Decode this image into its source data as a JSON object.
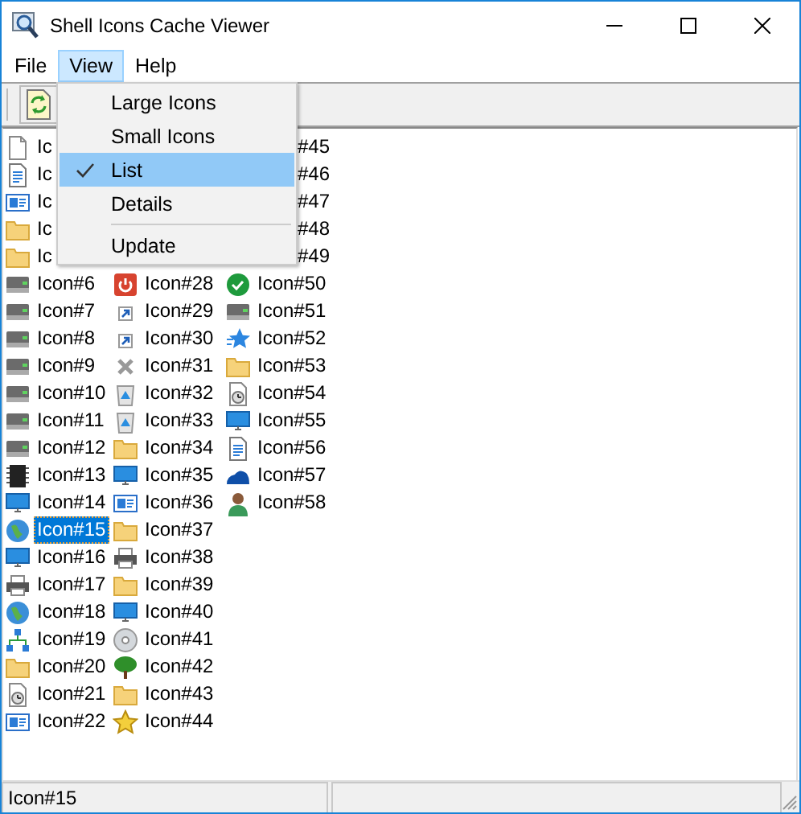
{
  "window": {
    "title": "Shell Icons Cache Viewer"
  },
  "menu_bar": [
    {
      "label": "File",
      "selected": false
    },
    {
      "label": "View",
      "selected": true
    },
    {
      "label": "Help",
      "selected": false
    }
  ],
  "dropdown": [
    {
      "kind": "option",
      "label": "Large Icons",
      "checked": false,
      "selected": false
    },
    {
      "kind": "option",
      "label": "Small Icons",
      "checked": false,
      "selected": false
    },
    {
      "kind": "option",
      "label": "List",
      "checked": true,
      "selected": true
    },
    {
      "kind": "option",
      "label": "Details",
      "checked": false,
      "selected": false
    },
    {
      "kind": "separator"
    },
    {
      "kind": "option",
      "label": "Update",
      "checked": false,
      "selected": false
    }
  ],
  "icon_list": {
    "columns": [
      {
        "items": [
          {
            "kind": "item",
            "label": "Ic",
            "selected": false
          },
          {
            "kind": "item",
            "label": "Ic",
            "selected": false
          },
          {
            "kind": "item",
            "label": "Ic",
            "selected": false
          },
          {
            "kind": "item",
            "label": "Ic",
            "selected": false
          },
          {
            "kind": "item",
            "label": "Ic",
            "selected": false
          },
          {
            "kind": "item",
            "label": "Icon#6",
            "selected": false
          },
          {
            "kind": "item",
            "label": "Icon#7",
            "selected": false
          },
          {
            "kind": "item",
            "label": "Icon#8",
            "selected": false
          },
          {
            "kind": "item",
            "label": "Icon#9",
            "selected": false
          },
          {
            "kind": "item",
            "label": "Icon#10",
            "selected": false
          },
          {
            "kind": "item",
            "label": "Icon#11",
            "selected": false
          },
          {
            "kind": "item",
            "label": "Icon#12",
            "selected": false
          },
          {
            "kind": "item",
            "label": "Icon#13",
            "selected": false
          },
          {
            "kind": "item",
            "label": "Icon#14",
            "selected": false
          },
          {
            "kind": "item",
            "label": "Icon#15",
            "selected": true
          },
          {
            "kind": "item",
            "label": "Icon#16",
            "selected": false
          },
          {
            "kind": "item",
            "label": "Icon#17",
            "selected": false
          },
          {
            "kind": "item",
            "label": "Icon#18",
            "selected": false
          },
          {
            "kind": "item",
            "label": "Icon#19",
            "selected": false
          },
          {
            "kind": "item",
            "label": "Icon#20",
            "selected": false
          },
          {
            "kind": "item",
            "label": "Icon#21",
            "selected": false
          },
          {
            "kind": "item",
            "label": "Icon#22",
            "selected": false
          }
        ]
      },
      {
        "items": [
          {
            "kind": "item",
            "label": "Icon#28",
            "selected": false
          },
          {
            "kind": "item",
            "label": "Icon#29",
            "selected": false
          },
          {
            "kind": "item",
            "label": "Icon#30",
            "selected": false
          },
          {
            "kind": "item",
            "label": "Icon#31",
            "selected": false
          },
          {
            "kind": "item",
            "label": "Icon#32",
            "selected": false
          },
          {
            "kind": "item",
            "label": "Icon#33",
            "selected": false
          },
          {
            "kind": "item",
            "label": "Icon#34",
            "selected": false
          },
          {
            "kind": "item",
            "label": "Icon#35",
            "selected": false
          },
          {
            "kind": "item",
            "label": "Icon#36",
            "selected": false
          },
          {
            "kind": "item",
            "label": "Icon#37",
            "selected": false
          },
          {
            "kind": "item",
            "label": "Icon#38",
            "selected": false
          },
          {
            "kind": "item",
            "label": "Icon#39",
            "selected": false
          },
          {
            "kind": "item",
            "label": "Icon#40",
            "selected": false
          },
          {
            "kind": "item",
            "label": "Icon#41",
            "selected": false
          },
          {
            "kind": "item",
            "label": "Icon#42",
            "selected": false
          },
          {
            "kind": "item",
            "label": "Icon#43",
            "selected": false
          },
          {
            "kind": "item",
            "label": "Icon#44",
            "selected": false
          }
        ]
      },
      {
        "items": [
          {
            "kind": "cut",
            "label": "#45",
            "selected": false
          },
          {
            "kind": "cut",
            "label": "#46",
            "selected": false
          },
          {
            "kind": "cut",
            "label": "#47",
            "selected": false
          },
          {
            "kind": "cut",
            "label": "#48",
            "selected": false
          },
          {
            "kind": "cut",
            "label": "#49",
            "selected": false
          },
          {
            "kind": "item",
            "label": "Icon#50",
            "selected": false
          },
          {
            "kind": "item",
            "label": "Icon#51",
            "selected": false
          },
          {
            "kind": "item",
            "label": "Icon#52",
            "selected": false
          },
          {
            "kind": "item",
            "label": "Icon#53",
            "selected": false
          },
          {
            "kind": "item",
            "label": "Icon#54",
            "selected": false
          },
          {
            "kind": "item",
            "label": "Icon#55",
            "selected": false
          },
          {
            "kind": "item",
            "label": "Icon#56",
            "selected": false
          },
          {
            "kind": "item",
            "label": "Icon#57",
            "selected": false
          },
          {
            "kind": "item",
            "label": "Icon#58",
            "selected": false
          }
        ]
      }
    ]
  },
  "status_bar": [
    "Icon#15"
  ]
}
